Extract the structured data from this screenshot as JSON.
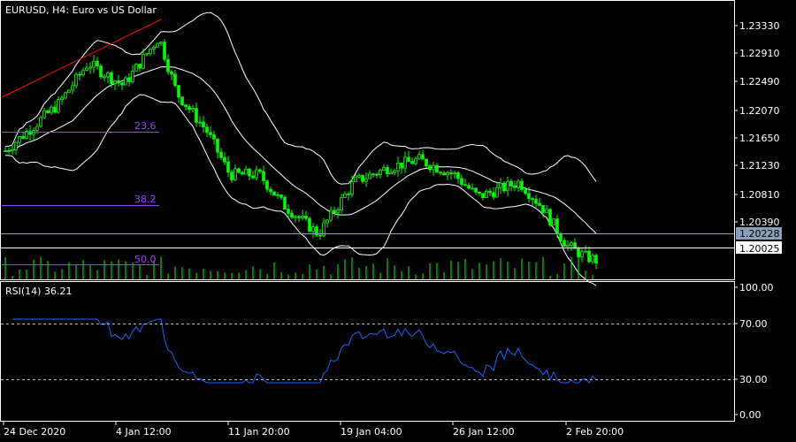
{
  "header": {
    "title": "EURUSD, H4:  Euro vs US Dollar"
  },
  "price_axis": {
    "ticks": [
      "1.23330",
      "1.22910",
      "1.22490",
      "1.22070",
      "1.21650",
      "1.21230",
      "1.20810",
      "1.20390"
    ],
    "bid_label": "1.20228",
    "ask_label": "1.20025"
  },
  "fibonacci": [
    {
      "level": "23.6"
    },
    {
      "level": "38.2"
    },
    {
      "level": "50.0"
    }
  ],
  "rsi": {
    "title": "RSI(14) 36.21",
    "ticks": [
      "100.00",
      "70.00",
      "30.00",
      "0.00"
    ]
  },
  "time_axis": {
    "labels": [
      "24 Dec 2020",
      "4 Jan 12:00",
      "11 Jan 20:00",
      "19 Jan 04:00",
      "26 Jan 12:00",
      "2 Feb 20:00"
    ]
  },
  "colors": {
    "background": "#000000",
    "candle": "#00ff00",
    "band": "#ffffff",
    "fib": "#a040ff",
    "trend": "#ff0000",
    "rsi_line": "#1e63ff",
    "text": "#ffffff"
  },
  "chart_data": {
    "type": "line",
    "symbol": "EURUSD",
    "timeframe": "H4",
    "ylim": [
      1.1999,
      1.2375
    ],
    "price_path": [
      {
        "t": 0,
        "p": 1.2172
      },
      {
        "t": 0.04,
        "p": 1.22
      },
      {
        "t": 0.09,
        "p": 1.2235
      },
      {
        "t": 0.14,
        "p": 1.229
      },
      {
        "t": 0.2,
        "p": 1.226
      },
      {
        "t": 0.26,
        "p": 1.2325
      },
      {
        "t": 0.29,
        "p": 1.225
      },
      {
        "t": 0.34,
        "p": 1.22
      },
      {
        "t": 0.38,
        "p": 1.214
      },
      {
        "t": 0.43,
        "p": 1.214
      },
      {
        "t": 0.47,
        "p": 1.21
      },
      {
        "t": 0.53,
        "p": 1.206
      },
      {
        "t": 0.59,
        "p": 1.213
      },
      {
        "t": 0.65,
        "p": 1.215
      },
      {
        "t": 0.7,
        "p": 1.216
      },
      {
        "t": 0.76,
        "p": 1.214
      },
      {
        "t": 0.8,
        "p": 1.211
      },
      {
        "t": 0.87,
        "p": 1.213
      },
      {
        "t": 0.91,
        "p": 1.2095
      },
      {
        "t": 0.95,
        "p": 1.2045
      },
      {
        "t": 0.98,
        "p": 1.203
      },
      {
        "t": 1.0,
        "p": 1.2025
      }
    ],
    "rsi_period": 14,
    "rsi_last": 36.21,
    "rsi_levels": [
      70,
      30
    ],
    "rsi_ylim": [
      0,
      100
    ]
  }
}
